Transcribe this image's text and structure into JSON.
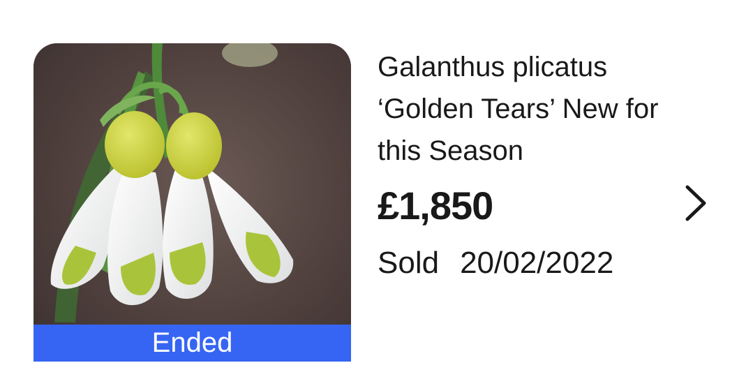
{
  "listing": {
    "title": "Galanthus plicatus ‘Golden Tears’ New for this Season",
    "price": "£1,850",
    "sold_label": "Sold",
    "sold_date": "20/02/2022",
    "badge": "Ended",
    "icons": {
      "chevron": "chevron-right-icon"
    },
    "colors": {
      "badge_bg": "#3665f3",
      "text": "#191919"
    }
  }
}
